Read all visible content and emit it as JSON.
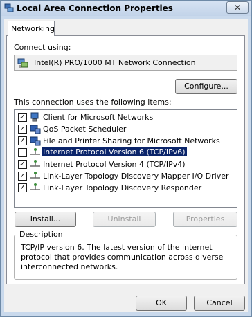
{
  "window": {
    "title": "Local Area Connection Properties",
    "close_glyph": "✕"
  },
  "tabs": [
    {
      "label": "Networking"
    }
  ],
  "connect_using": {
    "label": "Connect using:",
    "adapter": "Intel(R) PRO/1000 MT Network Connection",
    "configure_button": "Configure..."
  },
  "items": {
    "heading": "This connection uses the following items:",
    "list": [
      {
        "label": "Client for Microsoft Networks",
        "checked": true,
        "selected": false,
        "icon": "network-client-icon"
      },
      {
        "label": "QoS Packet Scheduler",
        "checked": true,
        "selected": false,
        "icon": "network-service-icon"
      },
      {
        "label": "File and Printer Sharing for Microsoft Networks",
        "checked": true,
        "selected": false,
        "icon": "network-service-icon"
      },
      {
        "label": "Internet Protocol Version 6 (TCP/IPv6)",
        "checked": false,
        "selected": true,
        "icon": "network-protocol-icon"
      },
      {
        "label": "Internet Protocol Version 4 (TCP/IPv4)",
        "checked": true,
        "selected": false,
        "icon": "network-protocol-icon"
      },
      {
        "label": "Link-Layer Topology Discovery Mapper I/O Driver",
        "checked": true,
        "selected": false,
        "icon": "network-protocol-icon"
      },
      {
        "label": "Link-Layer Topology Discovery Responder",
        "checked": true,
        "selected": false,
        "icon": "network-protocol-icon"
      }
    ]
  },
  "buttons": {
    "install": "Install...",
    "uninstall": "Uninstall",
    "properties": "Properties",
    "ok": "OK",
    "cancel": "Cancel"
  },
  "description": {
    "legend": "Description",
    "text": "TCP/IP version 6. The latest version of the internet protocol that provides communication across diverse interconnected networks."
  },
  "colors": {
    "selection": "#0a246a",
    "titlebar": "#c9d9ec",
    "dialog_bg": "#f0f0f0"
  }
}
